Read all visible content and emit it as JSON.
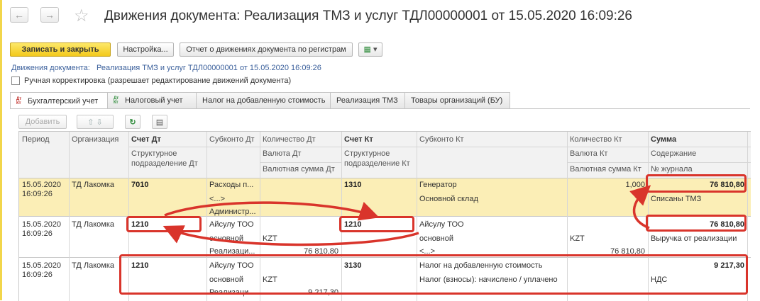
{
  "window": {
    "title": "Движения документа: Реализация ТМЗ и услуг ТДЛ00000001 от 15.05.2020 16:09:26"
  },
  "toolbar": {
    "save_close": "Записать и закрыть",
    "settings": "Настройка...",
    "report": "Отчет о движениях документа по регистрам"
  },
  "breadcrumb": {
    "label": "Движения документа:",
    "link": "Реализация ТМЗ и услуг ТДЛ00000001 от 15.05.2020 16:09:26"
  },
  "manual": {
    "label": "Ручная корректировка (разрешает редактирование движений документа)",
    "checked": false
  },
  "tabs": [
    {
      "label": "Бухгалтерский учет",
      "icon": "dt-kt-icon",
      "active": true
    },
    {
      "label": "Налоговый учет",
      "icon": "dt-kt-tax-icon",
      "active": false
    },
    {
      "label": "Налог на добавленную стоимость",
      "active": false
    },
    {
      "label": "Реализация ТМЗ",
      "active": false
    },
    {
      "label": "Товары организаций (БУ)",
      "active": false
    }
  ],
  "grid_toolbar": {
    "add": "Добавить"
  },
  "headers": {
    "period": "Период",
    "org": "Организация",
    "dt_account": "Счет Дт",
    "dt_subdiv": "Структурное подразделение Дт",
    "subconto_dt": "Субконто Дт",
    "qty_dt": "Количество Дт",
    "cur_dt": "Валюта Дт",
    "cur_sum_dt": "Валютная сумма Дт",
    "kt_account": "Счет Кт",
    "kt_subdiv": "Структурное подразделение Кт",
    "subconto_kt": "Субконто Кт",
    "qty_kt": "Количество Кт",
    "cur_kt": "Валюта Кт",
    "cur_sum_kt": "Валютная сумма Кт",
    "sum": "Сумма",
    "content": "Содержание",
    "journal": "№ журнала"
  },
  "rows": [
    {
      "date": "15.05.2020",
      "time": "16:09:26",
      "org": "ТД Лакомка",
      "dt": "7010",
      "sub_dt1": "Расходы п...",
      "sub_dt2": "<...>",
      "sub_dt3": "Администр...",
      "kt": "1310",
      "sub_kt1": "Генератор",
      "sub_kt2": "Основной склад",
      "qty_kt": "1,000",
      "sum": "76 810,80",
      "content": "Списаны ТМЗ"
    },
    {
      "date": "15.05.2020",
      "time": "16:09:26",
      "org": "ТД Лакомка",
      "dt": "1210",
      "sub_dt1": "Айсулу ТОО",
      "sub_dt2": "основной",
      "sub_dt3": "Реализаци...",
      "cur_dt": "KZT",
      "cur_sum_dt": "76 810,80",
      "kt": "1210",
      "sub_kt1": "Айсулу ТОО",
      "sub_kt2": "основной",
      "sub_kt3": "<...>",
      "cur_kt": "KZT",
      "cur_sum_kt": "76 810,80",
      "sum": "76 810,80",
      "content": "Выручка от реализации"
    },
    {
      "date": "15.05.2020",
      "time": "16:09:26",
      "org": "ТД Лакомка",
      "dt": "1210",
      "sub_dt1": "Айсулу ТОО",
      "sub_dt2": "основной",
      "sub_dt3": "Реализаци...",
      "cur_dt": "KZT",
      "cur_sum_dt": "9 217,30",
      "kt": "3130",
      "sub_kt1": "Налог на добавленную стоимость",
      "sub_kt2": "Налог (взносы): начислено / уплачено",
      "sum": "9 217,30",
      "content": "НДС"
    }
  ],
  "colors": {
    "highlight": "#d9342b",
    "row_selected": "#fbeeb6",
    "primary_button": "#f3c91c"
  }
}
